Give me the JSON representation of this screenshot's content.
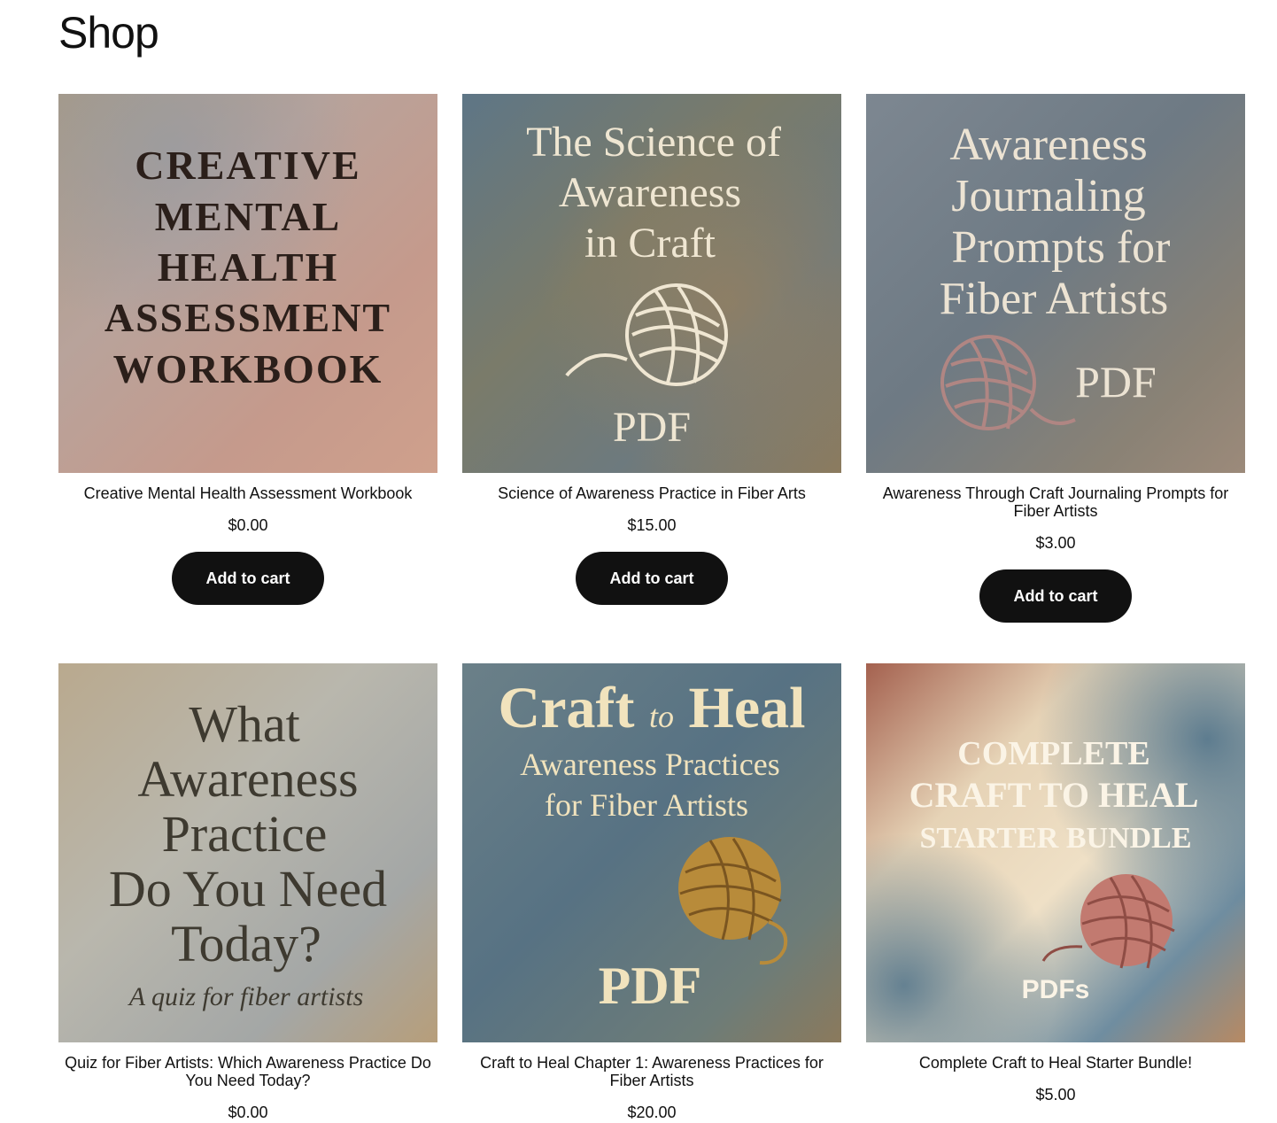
{
  "page": {
    "title": "Shop"
  },
  "products": [
    {
      "name": "Creative Mental Health Assessment Workbook",
      "price": "$0.00",
      "button": "Add to cart",
      "cover_lines": [
        "CREATIVE",
        "MENTAL",
        "HEALTH",
        "ASSESSMENT",
        "WORKBOOK"
      ]
    },
    {
      "name": "Science of Awareness Practice in Fiber Arts",
      "price": "$15.00",
      "button": "Add to cart",
      "cover_lines": [
        "The Science of",
        "Awareness",
        "in Craft"
      ],
      "cover_badge": "PDF"
    },
    {
      "name": "Awareness Through Craft Journaling Prompts for Fiber Artists",
      "price": "$3.00",
      "button": "Add to cart",
      "cover_lines": [
        "Awareness",
        "Journaling",
        "Prompts for",
        "Fiber Artists"
      ],
      "cover_badge": "PDF"
    },
    {
      "name": "Quiz for Fiber Artists: Which Awareness Practice Do You Need Today?",
      "price": "$0.00",
      "cover_lines": [
        "What",
        "Awareness",
        "Practice",
        "Do You Need",
        "Today?"
      ],
      "cover_subtitle": "A quiz for fiber artists"
    },
    {
      "name": "Craft to Heal Chapter 1: Awareness Practices for Fiber Artists",
      "price": "$20.00",
      "cover_title_a": "Craft",
      "cover_title_to": "to",
      "cover_title_b": "Heal",
      "cover_lines": [
        "Awareness Practices",
        "for Fiber Artists"
      ],
      "cover_badge": "PDF"
    },
    {
      "name": "Complete Craft to Heal Starter Bundle!",
      "price": "$5.00",
      "cover_lines": [
        "COMPLETE",
        "CRAFT TO HEAL",
        "STARTER BUNDLE"
      ],
      "cover_badge": "PDFs"
    }
  ],
  "colors": {
    "button_bg": "#111111",
    "button_text": "#ffffff",
    "text": "#111111"
  }
}
